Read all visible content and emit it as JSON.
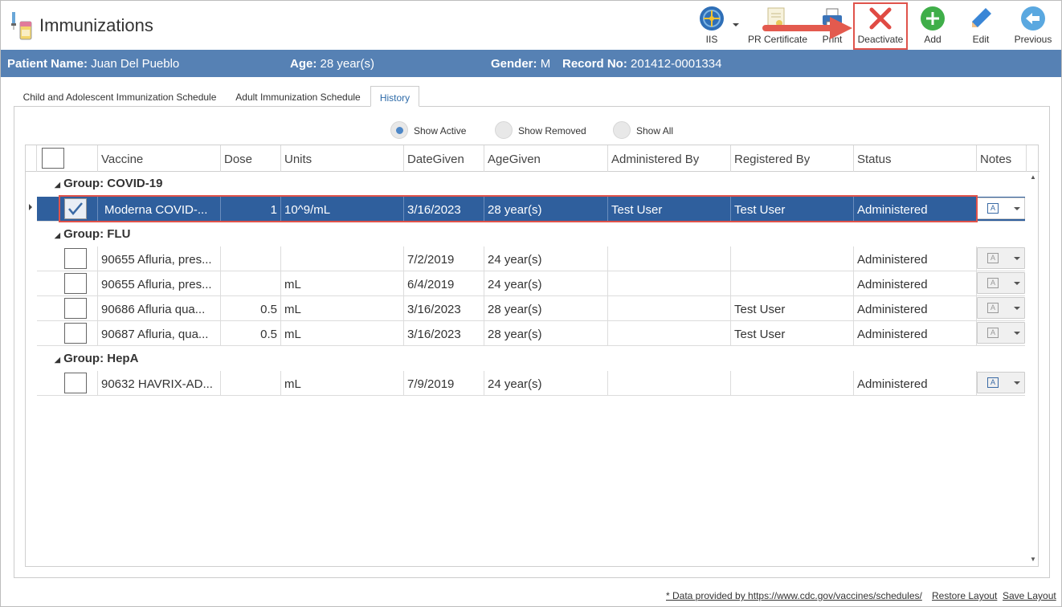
{
  "header": {
    "title": "Immunizations",
    "toolbar": [
      {
        "label": "IIS",
        "icon": "globe-network-icon"
      },
      {
        "label": "PR Certificate",
        "icon": "certificate-icon"
      },
      {
        "label": "Print",
        "icon": "printer-icon"
      },
      {
        "label": "Deactivate",
        "icon": "red-x-icon"
      },
      {
        "label": "Add",
        "icon": "green-plus-icon"
      },
      {
        "label": "Edit",
        "icon": "pencil-icon"
      },
      {
        "label": "Previous",
        "icon": "back-arrow-icon"
      }
    ]
  },
  "patient": {
    "name_label": "Patient Name:",
    "name": "Juan Del Pueblo",
    "age_label": "Age:",
    "age": "28 year(s)",
    "gender_label": "Gender:",
    "gender": "M",
    "record_label": "Record No:",
    "record": "201412-0001334"
  },
  "tabs": [
    {
      "label": "Child and Adolescent Immunization Schedule",
      "active": false
    },
    {
      "label": "Adult Immunization Schedule",
      "active": false
    },
    {
      "label": "History",
      "active": true
    }
  ],
  "filters": [
    {
      "label": "Show Active",
      "checked": true
    },
    {
      "label": "Show Removed",
      "checked": false
    },
    {
      "label": "Show All",
      "checked": false
    }
  ],
  "grid": {
    "columns": [
      "Vaccine",
      "Dose",
      "Units",
      "DateGiven",
      "AgeGiven",
      "Administered By",
      "Registered By",
      "Status",
      "Notes"
    ],
    "groups": [
      {
        "label": "Group: COVID-19",
        "rows": [
          {
            "checked": true,
            "selected": true,
            "vaccine": "Moderna COVID-...",
            "dose": "1",
            "units": "10^9/mL",
            "date": "3/16/2023",
            "age": "28 year(s)",
            "admin_by": "Test User",
            "reg_by": "Test User",
            "status": "Administered"
          }
        ]
      },
      {
        "label": "Group: FLU",
        "rows": [
          {
            "checked": false,
            "selected": false,
            "vaccine": "90655 Afluria, pres...",
            "dose": "",
            "units": "",
            "date": "7/2/2019",
            "age": "24 year(s)",
            "admin_by": "",
            "reg_by": "",
            "status": "Administered"
          },
          {
            "checked": false,
            "selected": false,
            "vaccine": "90655 Afluria, pres...",
            "dose": "",
            "units": "mL",
            "date": "6/4/2019",
            "age": "24 year(s)",
            "admin_by": "",
            "reg_by": "",
            "status": "Administered"
          },
          {
            "checked": false,
            "selected": false,
            "vaccine": "90686 Afluria qua...",
            "dose": "0.5",
            "units": "mL",
            "date": "3/16/2023",
            "age": "28 year(s)",
            "admin_by": "",
            "reg_by": "Test User",
            "status": "Administered"
          },
          {
            "checked": false,
            "selected": false,
            "vaccine": "90687 Afluria, qua...",
            "dose": "0.5",
            "units": "mL",
            "date": "3/16/2023",
            "age": "28 year(s)",
            "admin_by": "",
            "reg_by": "Test User",
            "status": "Administered"
          }
        ]
      },
      {
        "label": "Group: HepA",
        "rows": [
          {
            "checked": false,
            "selected": false,
            "vaccine": "90632 HAVRIX-AD...",
            "dose": "",
            "units": "mL",
            "date": "7/9/2019",
            "age": "24 year(s)",
            "admin_by": "",
            "reg_by": "",
            "status": "Administered"
          }
        ]
      }
    ]
  },
  "footer": {
    "data_note": "* Data provided by https://www.cdc.gov/vaccines/schedules/",
    "restore": "Restore Layout",
    "save": "Save Layout"
  },
  "colors": {
    "patient_bar": "#5681b4",
    "selected_row": "#2f5f9d",
    "highlight": "#e0534b"
  }
}
